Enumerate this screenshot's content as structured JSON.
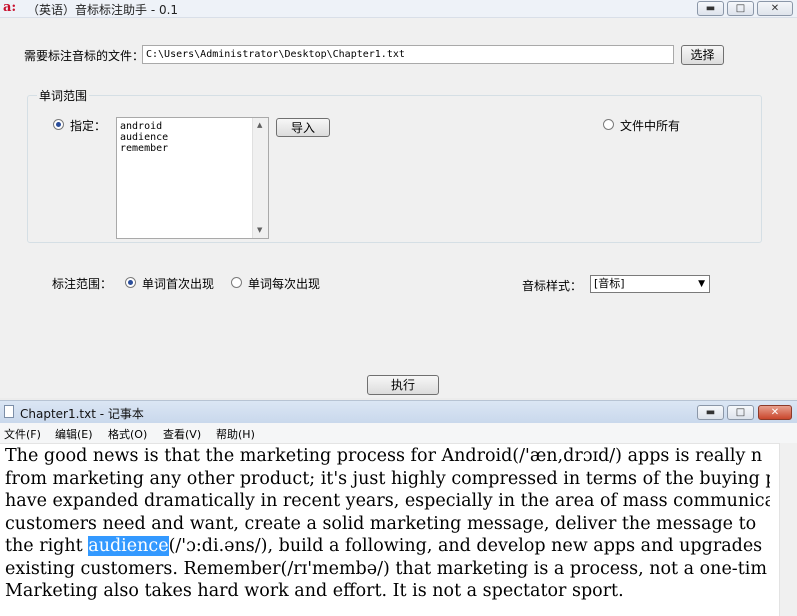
{
  "tool": {
    "title": "（英语）音标标注助手 - 0.1",
    "logo_text": "a:",
    "window_controls": {
      "minimize": "▬",
      "maximize": "□",
      "close": "✕"
    },
    "file_label": "需要标注音标的文件：",
    "file_path": "C:\\Users\\Administrator\\Desktop\\Chapter1.txt",
    "choose_button": "选择",
    "word_range_title": "单词范围",
    "specify_label": "指定：",
    "word_list": "android\naudience\nremember",
    "import_button": "导入",
    "all_in_file_label": "文件中所有",
    "annotate_range_label": "标注范围：",
    "first_occurrence_label": "单词首次出现",
    "every_occurrence_label": "单词每次出现",
    "phonetic_style_label": "音标样式：",
    "phonetic_style_value": "[音标]",
    "execute_button": "执行",
    "state": {
      "specify_selected": true,
      "first_occurrence_selected": true
    }
  },
  "notepad": {
    "title": "Chapter1.txt - 记事本",
    "menu": [
      "文件(F)",
      "编辑(E)",
      "格式(O)",
      "查看(V)",
      "帮助(H)"
    ],
    "lines": [
      {
        "text": "The good news is that the marketing process for Android(/'æn,drɔɪd/) apps is really n"
      },
      {
        "text": "from marketing any other product; it's just highly compressed in terms of the buying p"
      },
      {
        "text": "have expanded dramatically in recent years, especially in the area of mass communica"
      },
      {
        "text": "customers need and want, create a solid marketing message, deliver the message to"
      },
      {
        "before": "the right ",
        "highlight": "audience",
        "after": "(/'ɔ:di.əns/), build a following, and develop new apps and upgrades"
      },
      {
        "text": "existing customers. Remember(/rɪ'membə/) that marketing is a process, not a one-tim"
      },
      {
        "text": "Marketing also takes hard work and effort. It is not a spectator sport."
      }
    ]
  },
  "colors": {
    "highlight": "#3399ff",
    "logo": "#c8102e"
  }
}
